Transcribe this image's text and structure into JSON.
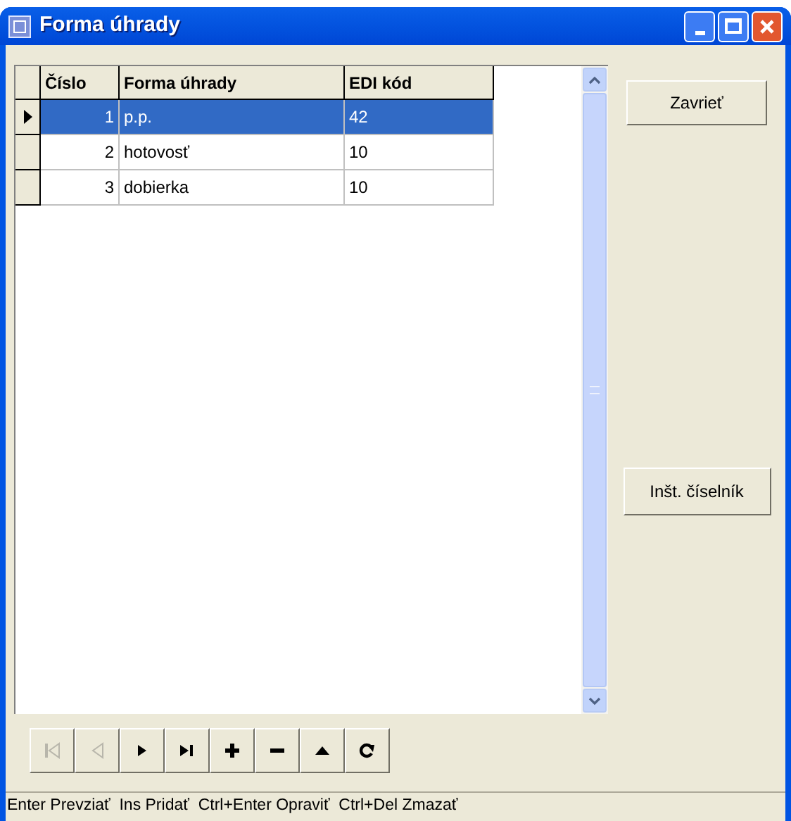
{
  "window": {
    "title": "Forma úhrady"
  },
  "table": {
    "columns": [
      "Číslo",
      "Forma úhrady",
      "EDI kód"
    ],
    "rows": [
      {
        "cells": [
          "1",
          "p.p.",
          "42"
        ],
        "selected": true
      },
      {
        "cells": [
          "2",
          "hotovosť",
          "10"
        ],
        "selected": false
      },
      {
        "cells": [
          "3",
          "dobierka",
          "10"
        ],
        "selected": false
      }
    ]
  },
  "buttons": [
    {
      "label": "Zavrieť"
    },
    {
      "label": "Inšt. číselník"
    }
  ],
  "navigator": [
    {
      "kind": "first",
      "disabled": true
    },
    {
      "kind": "prior",
      "disabled": true
    },
    {
      "kind": "next",
      "disabled": false
    },
    {
      "kind": "last",
      "disabled": false
    },
    {
      "kind": "insert",
      "disabled": false
    },
    {
      "kind": "delete",
      "disabled": false
    },
    {
      "kind": "post",
      "disabled": false
    },
    {
      "kind": "refresh",
      "disabled": false
    }
  ],
  "status_bar": {
    "text": "Enter Prevziať  Ins Pridať  Ctrl+Enter Opraviť  Ctrl+Del Zmazať"
  }
}
